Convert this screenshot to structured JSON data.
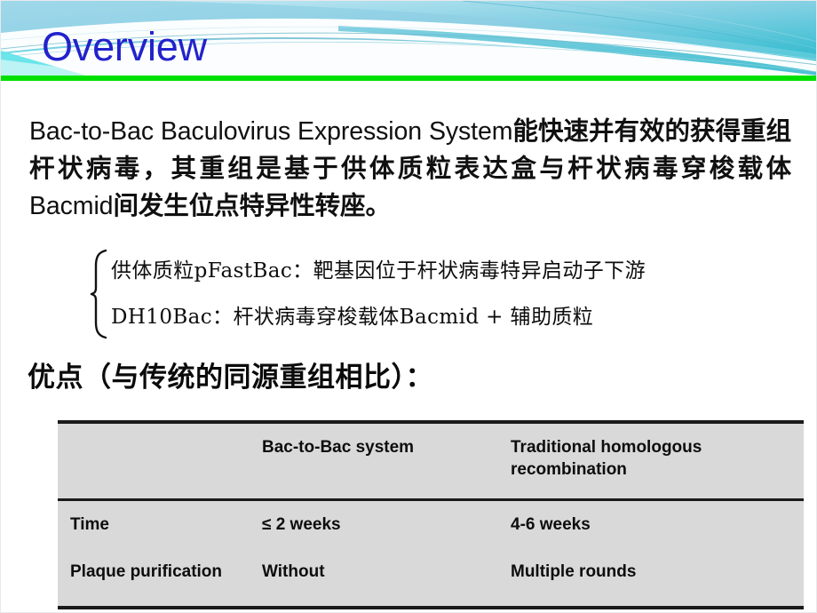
{
  "slide": {
    "title": "Overview",
    "title_color": "#2222cc",
    "accent_bar_color": "#00e000",
    "banner_gradient_top": "#7c94a9",
    "banner_gradient_bottom": "#3fe9e9"
  },
  "lead_paragraph": {
    "segment_1_en": "Bac-to-Bac Baculovirus Expression System",
    "segment_2_cn": "能快速并有效的获得重组杆状病毒，其重组是基于供体质粒表达盒与杆状病毒穿梭载体",
    "segment_3_en": "Bacmid",
    "segment_4_cn": "间发生位点特异性转座。"
  },
  "brace_list": {
    "items": [
      "供体质粒pFastBac：靶基因位于杆状病毒特异启动子下游",
      "DH10Bac：杆状病毒穿梭载体Bacmid + 辅助质粒"
    ]
  },
  "advantages": {
    "heading": "优点（与传统的同源重组相比）："
  },
  "comparison_table": {
    "headers": [
      "",
      "Bac-to-Bac system",
      "Traditional homologous recombination"
    ],
    "rows": [
      {
        "label": "Time",
        "bac_to_bac": "≤ 2 weeks",
        "traditional": "4-6 weeks"
      },
      {
        "label": "Plaque purification",
        "bac_to_bac": "Without",
        "traditional": "Multiple rounds"
      }
    ],
    "background_color": "#d9d9d9",
    "rule_color": "#1a1a1a"
  }
}
